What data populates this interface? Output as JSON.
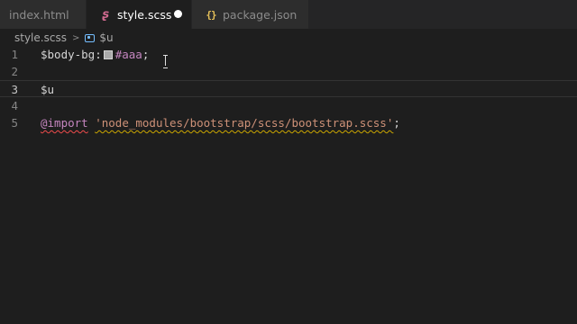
{
  "tabs": [
    {
      "label": "index.html",
      "icon": "html-file-icon",
      "active": false
    },
    {
      "label": "style.scss",
      "icon": "sass-file-icon",
      "active": true,
      "unsaved": true
    },
    {
      "label": "package.json",
      "icon": "json-file-icon",
      "active": false
    }
  ],
  "breadcrumb": {
    "file": "style.scss",
    "separator": ">",
    "symbol": "$u"
  },
  "editor": {
    "lines": [
      {
        "number": "1",
        "var": "$body-bg:",
        "color": "#aaa",
        "end": ";"
      },
      {
        "number": "2"
      },
      {
        "number": "3",
        "text": "$u",
        "current": true
      },
      {
        "number": "4"
      },
      {
        "number": "5",
        "keyword": "@import",
        "string": "'node_modules/bootstrap/scss/bootstrap.scss'",
        "end": ";"
      }
    ]
  },
  "colors": {
    "editor_bg": "#1e1e1e",
    "tab_inactive_bg": "#2d2d2d",
    "keyword": "#c586c0",
    "string": "#ce9178",
    "swatch": "#aaaaaa"
  }
}
